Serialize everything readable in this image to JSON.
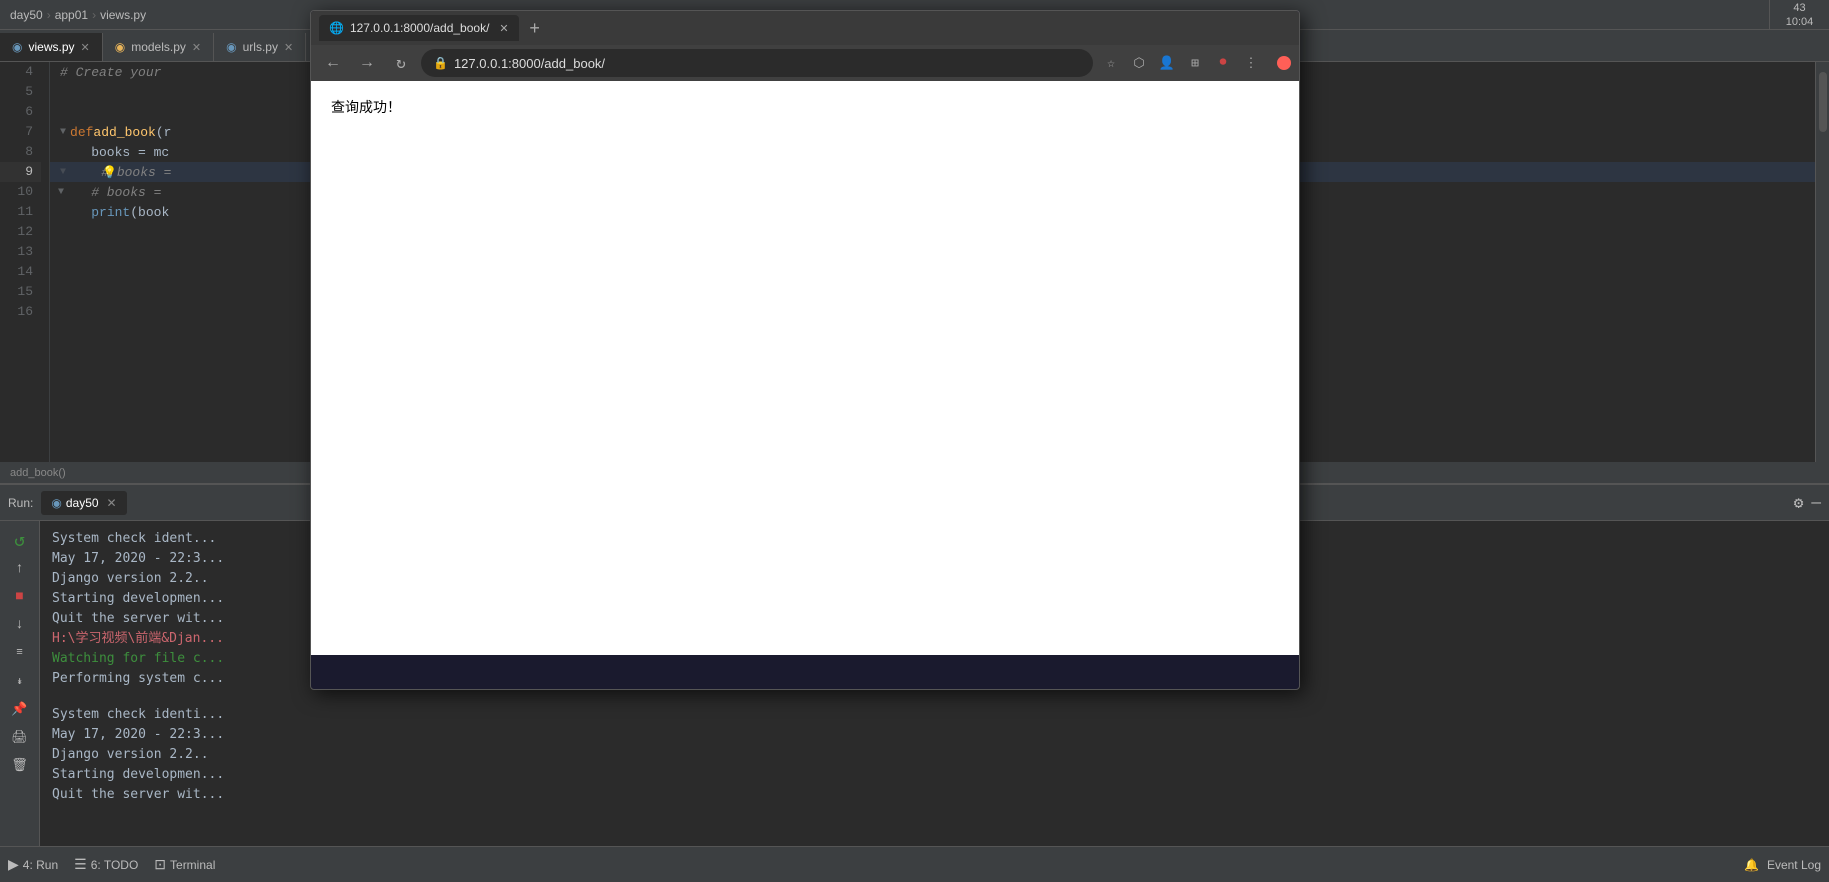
{
  "ide": {
    "title": "day50",
    "breadcrumb": [
      "day50",
      "app01",
      "views.py"
    ],
    "tabs": [
      {
        "label": "views.py",
        "icon": "views-icon",
        "active": true
      },
      {
        "label": "models.py",
        "icon": "models-icon",
        "active": false
      },
      {
        "label": "urls.py",
        "icon": "urls-icon",
        "active": false
      }
    ],
    "breadcrumb_path": "add_book()",
    "clock": "43\n10:04"
  },
  "code": {
    "lines": [
      {
        "num": "4",
        "content": "# Create your",
        "type": "comment",
        "highlight": false
      },
      {
        "num": "5",
        "content": "",
        "type": "empty",
        "highlight": false
      },
      {
        "num": "6",
        "content": "",
        "type": "empty",
        "highlight": false
      },
      {
        "num": "7",
        "content": "def add_book(r",
        "type": "code",
        "highlight": false
      },
      {
        "num": "8",
        "content": "    books = mc",
        "type": "code",
        "highlight": false
      },
      {
        "num": "9",
        "content": "    # books =",
        "type": "comment",
        "highlight": true
      },
      {
        "num": "10",
        "content": "    # books =",
        "type": "comment",
        "highlight": false
      },
      {
        "num": "11",
        "content": "    print(book",
        "type": "code",
        "highlight": false
      },
      {
        "num": "12",
        "content": "",
        "type": "empty",
        "highlight": false
      },
      {
        "num": "13",
        "content": "",
        "type": "empty",
        "highlight": false
      },
      {
        "num": "14",
        "content": "",
        "type": "empty",
        "highlight": false
      },
      {
        "num": "15",
        "content": "",
        "type": "empty",
        "highlight": false
      },
      {
        "num": "16",
        "content": "",
        "type": "empty",
        "highlight": false
      }
    ]
  },
  "run_panel": {
    "label": "Run:",
    "tab_label": "day50",
    "output_lines": [
      {
        "text": "System check ident...",
        "color": "normal"
      },
      {
        "text": "May 17, 2020 - 22:3...",
        "color": "normal"
      },
      {
        "text": "Django version 2.2....",
        "color": "normal"
      },
      {
        "text": "Starting developmen...",
        "color": "normal"
      },
      {
        "text": "Quit the server wit...",
        "color": "normal"
      },
      {
        "text": "H:\\学习视频\\前端&Djan...",
        "color": "red"
      },
      {
        "text": "Watching for file c...",
        "color": "green"
      },
      {
        "text": "Performing system c...",
        "color": "normal"
      },
      {
        "text": "",
        "color": "normal"
      },
      {
        "text": "System check identi...",
        "color": "normal"
      },
      {
        "text": "May 17, 2020 - 22:3...",
        "color": "normal"
      },
      {
        "text": "Django version 2.2....",
        "color": "normal"
      },
      {
        "text": "Starting developmen...",
        "color": "normal"
      },
      {
        "text": "Quit the server wit...",
        "color": "normal"
      }
    ]
  },
  "status_bar": {
    "items": [
      {
        "icon": "▶",
        "label": "4: Run"
      },
      {
        "icon": "≡",
        "label": "6: TODO"
      },
      {
        "icon": "⊡",
        "label": "Terminal"
      }
    ],
    "right": {
      "settings_icon": "⚙",
      "event_log": "Event Log",
      "notification_icon": "🔔"
    }
  },
  "browser": {
    "tab_label": "127.0.0.1:8000/add_book/",
    "url": "127.0.0.1:8000/add_book/",
    "url_full": "127.0.0.1:8000/add_book/",
    "content_text": "查询成功！",
    "nav_buttons": [
      "←",
      "→",
      "↻"
    ]
  }
}
